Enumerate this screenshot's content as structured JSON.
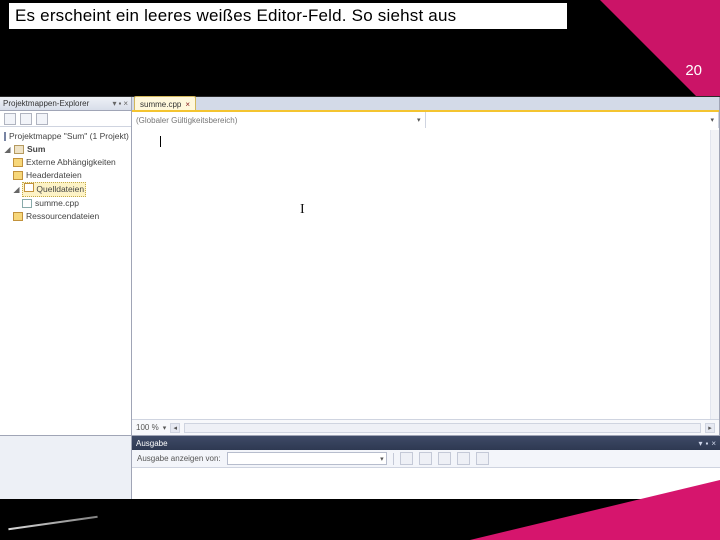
{
  "slide": {
    "heading": "Es erscheint ein leeres weißes Editor-Feld. So siehst aus",
    "page_number": "20"
  },
  "sx": {
    "title": "Projektmappen-Explorer",
    "pin": "▾",
    "dock": "▪",
    "close": "×",
    "solution": "Projektmappe \"Sum\" (1 Projekt)",
    "project": "Sum",
    "ext_deps": "Externe Abhängigkeiten",
    "headers": "Headerdateien",
    "sources": "Quelldateien",
    "source_file": "summe.cpp",
    "resources": "Ressourcendateien"
  },
  "editor": {
    "tab_label": "summe.cpp",
    "tab_close": "×",
    "scope_dd": "(Globaler Gültigkeitsbereich)",
    "member_dd": "",
    "zoom": "100 %"
  },
  "output": {
    "title": "Ausgabe",
    "show_from": "Ausgabe anzeigen von:"
  }
}
